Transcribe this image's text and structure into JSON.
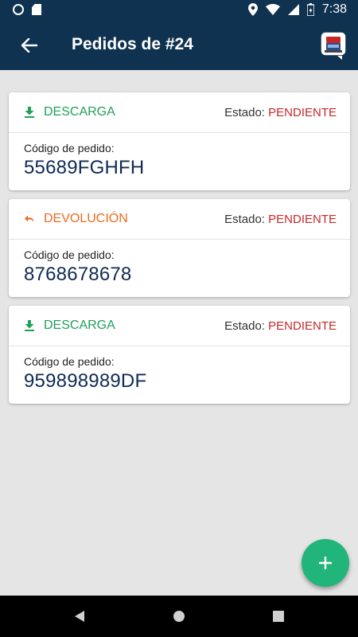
{
  "status_bar": {
    "time": "7:38"
  },
  "app_bar": {
    "title": "Pedidos de #24"
  },
  "orders": [
    {
      "type_label": "DESCARGA",
      "type_color": "#21a05a",
      "type_icon": "download-icon",
      "estado_label": "Estado: ",
      "estado_value": "PENDIENTE",
      "code_label": "Código de pedido:",
      "code": "55689FGHFH"
    },
    {
      "type_label": "DEVOLUCIÓN",
      "type_color": "#ec6a1e",
      "type_icon": "undo-icon",
      "estado_label": "Estado: ",
      "estado_value": "PENDIENTE",
      "code_label": "Código de pedido:",
      "code": "8768678678"
    },
    {
      "type_label": "DESCARGA",
      "type_color": "#21a05a",
      "type_icon": "download-icon",
      "estado_label": "Estado: ",
      "estado_value": "PENDIENTE",
      "code_label": "Código de pedido:",
      "code": "959898989DF"
    }
  ],
  "colors": {
    "primary": "#0f3250",
    "fab": "#21b57a",
    "pending": "#c62828"
  }
}
